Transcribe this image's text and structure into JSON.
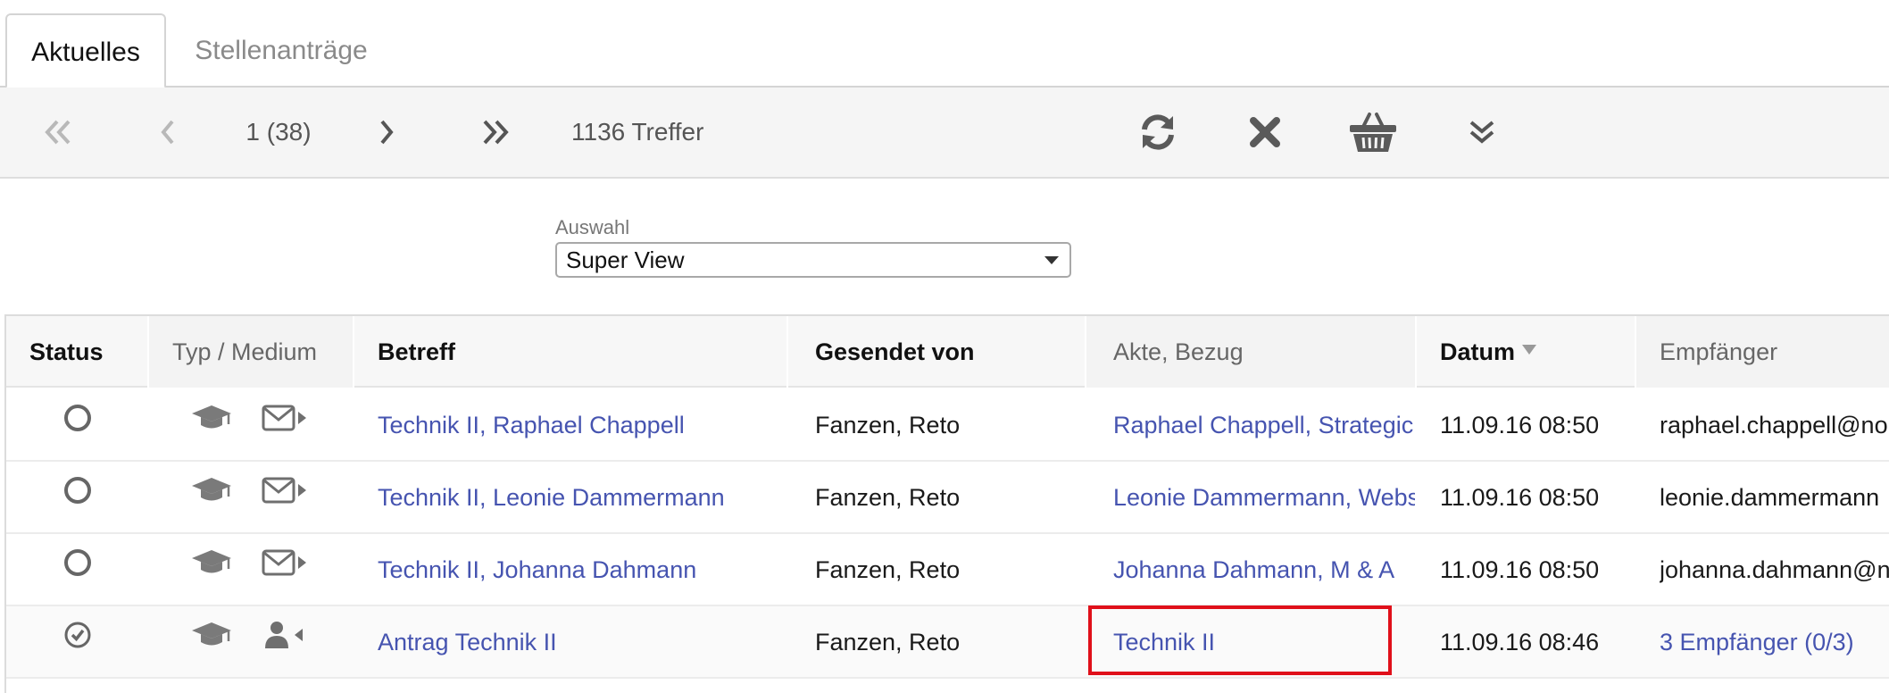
{
  "tabs": [
    {
      "label": "Aktuelles",
      "active": true
    },
    {
      "label": "Stellenanträge",
      "active": false
    }
  ],
  "toolbar": {
    "first_icon": "double-chevron-left-icon",
    "prev_icon": "chevron-left-icon",
    "page_indicator": "1 (38)",
    "next_icon": "chevron-right-icon",
    "last_icon": "double-chevron-right-icon",
    "hits": "1136 Treffer",
    "refresh_icon": "refresh-icon",
    "clear_icon": "close-icon",
    "basket_icon": "basket-icon",
    "expand_icon": "double-chevron-down-icon"
  },
  "selection": {
    "label": "Auswahl",
    "value": "Super View"
  },
  "table": {
    "columns": [
      "Status",
      "Typ / Medium",
      "Betreff",
      "Gesendet von",
      "Akte, Bezug",
      "Datum",
      "Empfänger"
    ],
    "sorted_column": "Datum",
    "rows": [
      {
        "status_icon": "circle-empty-icon",
        "type_icon": "graduation-cap-icon",
        "medium_icon": "envelope-outgoing-icon",
        "betreff": "Technik II, Raphael Chappell",
        "gesendet_von": "Fanzen, Reto",
        "akte": "Raphael Chappell, Strategic I",
        "datum": "11.09.16 08:50",
        "empfaenger": "raphael.chappell@nor",
        "empfaenger_link": false
      },
      {
        "status_icon": "circle-empty-icon",
        "type_icon": "graduation-cap-icon",
        "medium_icon": "envelope-outgoing-icon",
        "betreff": "Technik II, Leonie Dammermann",
        "gesendet_von": "Fanzen, Reto",
        "akte": "Leonie Dammermann, Webs",
        "datum": "11.09.16 08:50",
        "empfaenger": "leonie.dammermann",
        "empfaenger_link": false
      },
      {
        "status_icon": "circle-empty-icon",
        "type_icon": "graduation-cap-icon",
        "medium_icon": "envelope-outgoing-icon",
        "betreff": "Technik II, Johanna Dahmann",
        "gesendet_von": "Fanzen, Reto",
        "akte": "Johanna Dahmann, M & A",
        "datum": "11.09.16 08:50",
        "empfaenger": "johanna.dahmann@n",
        "empfaenger_link": false
      },
      {
        "status_icon": "circle-check-icon",
        "type_icon": "graduation-cap-icon",
        "medium_icon": "person-incoming-icon",
        "betreff": "Antrag Technik II",
        "gesendet_von": "Fanzen, Reto",
        "akte": "Technik II",
        "datum": "11.09.16 08:46",
        "empfaenger": "3 Empfänger (0/3)",
        "empfaenger_link": true
      }
    ]
  },
  "colors": {
    "link": "#4654b0",
    "highlight": "#e0101a",
    "toolbar_bg": "#f5f5f5"
  }
}
